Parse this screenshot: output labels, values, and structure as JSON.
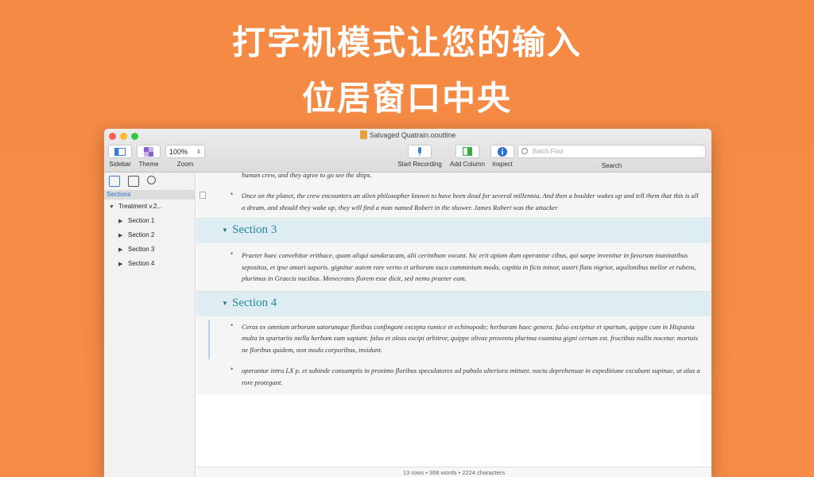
{
  "headline": {
    "line1": "打字机模式让您的输入",
    "line2": "位居窗口中央"
  },
  "window": {
    "title": "Salvaged Quatrain.ooutline",
    "toolbar": {
      "sidebar_label": "Sidebar",
      "theme_label": "Theme",
      "zoom_value": "100%",
      "zoom_label": "Zoom",
      "start_recording_label": "Start Recording",
      "add_column_label": "Add Column",
      "inspect_label": "Inspect",
      "search_placeholder": "Batch Find",
      "search_label": "Search"
    }
  },
  "sidebar": {
    "sections_header": "Sections",
    "root": "Treatment v.2...",
    "items": [
      "Section 1",
      "Section 2",
      "Section 3",
      "Section 4"
    ]
  },
  "document": {
    "top_partial": "human crew, and they agree to go see the ships.",
    "para_a": "Once on the planet, the crew encounters an alien philosopher known to have been dead for several millennia. And then a boulder wakes up and tell them that this is all a dream, and should they wake up, they will find a man named Robert in the shower. James Robert was the attacker",
    "sections": [
      {
        "title": "Section 3",
        "paras": [
          "Praeter haec convehitur erithace, quam aliqui sandaracam, alii cerinthum vocant. hic erit apium dum operantur cibus, qui saepe invenitur in favorum inanitatibus sepositus, et ipse amari saporis. gignitur autem rore verno et arborum suco cumminium modo, capitia in ficis minor, austri flatu nigrior, aquilonibus melior et rubens, plurimus in Graecis nucibus. Menecrates florem esse dicit, sed nemo praeter eum."
        ]
      },
      {
        "title": "Section 4",
        "paras": [
          "Ceras ex omnium arborum satorumque floribus confingunt excepta rumice et echinopode; herbarum haec genera. falso excipitur et spartum, quippe cum in Hispania multa in spartariis mella herbam eam sapiant. falso et oleas excipi arbitror, quippe olivae proventu plurima examina gigni certum est. fructibus nullis nocetur. mortuis ne floribus quidem, non modo corporibus, insidunt.",
          "operantur intra LX p. et subinde consumptis in proximo floribus speculatores ad pabula ulteriora mittunt. noctu deprehensae in expeditione excubant supinae, ut alas a rore protegant."
        ]
      }
    ],
    "status": "13 rows • 368 words • 2224 characters"
  },
  "colors": {
    "background": "#f68a45",
    "section_title": "#2789a3",
    "section_band": "#ddedf1",
    "accent_blue": "#2a6ecf"
  }
}
